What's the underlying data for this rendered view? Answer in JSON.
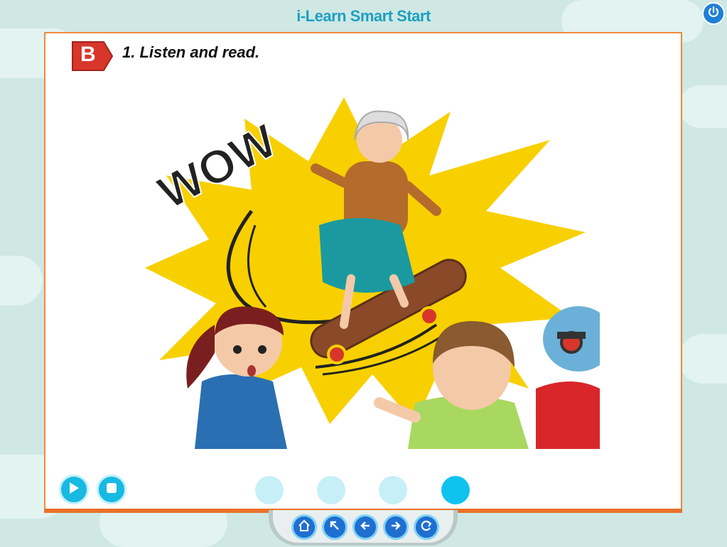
{
  "app": {
    "title": "i-Learn Smart Start"
  },
  "header": {
    "power_icon": "power-icon"
  },
  "lesson": {
    "section_badge": "B",
    "instruction": "1. Listen and read."
  },
  "illustration": {
    "exclamation": "WOW"
  },
  "player": {
    "play_icon": "play-icon",
    "stop_icon": "stop-icon",
    "slides_total": 4,
    "active_slide": 4
  },
  "nav": {
    "items": [
      {
        "icon": "home-icon"
      },
      {
        "icon": "arrow-up-left-icon"
      },
      {
        "icon": "arrow-left-icon"
      },
      {
        "icon": "arrow-right-icon"
      },
      {
        "icon": "refresh-icon"
      }
    ]
  },
  "colors": {
    "title": "#1f9fc0",
    "card_border": "#f08a3c",
    "badge": "#d8362b",
    "control": "#18b9e3",
    "nav": "#1f6fd1"
  }
}
